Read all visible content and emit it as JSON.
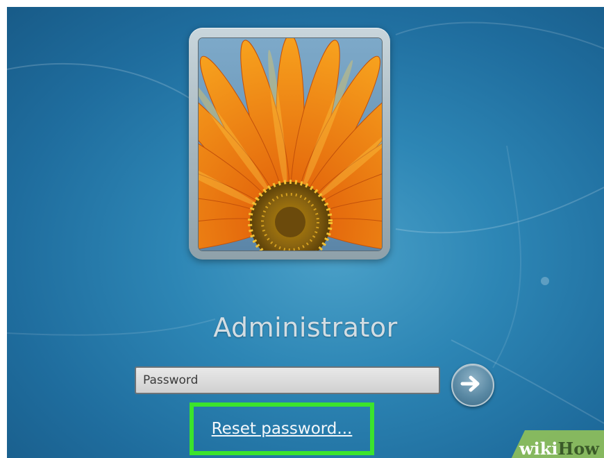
{
  "login": {
    "username": "Administrator",
    "password_placeholder": "Password",
    "password_value": "",
    "reset_link_label": "Reset password..."
  },
  "icons": {
    "avatar": "orange-flower-avatar",
    "submit": "arrow-right-icon"
  },
  "watermark": {
    "part1": "wiki",
    "part2": "How"
  },
  "colors": {
    "highlight": "#3be42c",
    "background": "#2d86b5",
    "username_text": "#d3dde3"
  }
}
